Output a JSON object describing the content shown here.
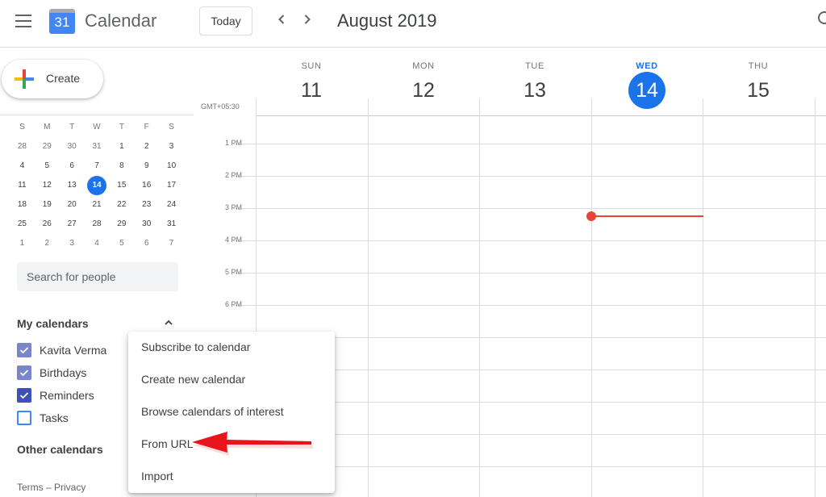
{
  "header": {
    "app_title": "Calendar",
    "logo_number": "31",
    "today_label": "Today",
    "prev_label": "‹",
    "next_label": "›",
    "month_title": "August 2019"
  },
  "sidebar": {
    "create_label": "Create",
    "mini_calendar": {
      "weekdays": [
        "S",
        "M",
        "T",
        "W",
        "T",
        "F",
        "S"
      ],
      "weeks": [
        [
          "28",
          "29",
          "30",
          "31",
          "1",
          "2",
          "3"
        ],
        [
          "4",
          "5",
          "6",
          "7",
          "8",
          "9",
          "10"
        ],
        [
          "11",
          "12",
          "13",
          "14",
          "15",
          "16",
          "17"
        ],
        [
          "18",
          "19",
          "20",
          "21",
          "22",
          "23",
          "24"
        ],
        [
          "25",
          "26",
          "27",
          "28",
          "29",
          "30",
          "31"
        ],
        [
          "1",
          "2",
          "3",
          "4",
          "5",
          "6",
          "7"
        ]
      ],
      "today": "14"
    },
    "search_people_placeholder": "Search for people",
    "my_calendars_title": "My calendars",
    "my_calendars": [
      {
        "label": "Kavita Verma",
        "checked": true,
        "color": "#7986cb"
      },
      {
        "label": "Birthdays",
        "checked": true,
        "color": "#7986cb"
      },
      {
        "label": "Reminders",
        "checked": true,
        "color": "#3f51b5"
      },
      {
        "label": "Tasks",
        "checked": false,
        "color": "#4285f4"
      }
    ],
    "other_calendars_title": "Other calendars",
    "footer": "Terms – Privacy"
  },
  "week_view": {
    "timezone": "GMT+05:30",
    "days": [
      {
        "dow": "SUN",
        "num": "11",
        "today": false
      },
      {
        "dow": "MON",
        "num": "12",
        "today": false
      },
      {
        "dow": "TUE",
        "num": "13",
        "today": false
      },
      {
        "dow": "WED",
        "num": "14",
        "today": true
      },
      {
        "dow": "THU",
        "num": "15",
        "today": false
      }
    ],
    "time_labels": [
      "1 PM",
      "2 PM",
      "3 PM",
      "4 PM",
      "5 PM",
      "6 PM"
    ]
  },
  "add_calendar_menu": {
    "items": [
      "Subscribe to calendar",
      "Create new calendar",
      "Browse calendars of interest",
      "From URL",
      "Import"
    ]
  },
  "annotation": {
    "color": "#e8141c",
    "points_to": "From URL"
  },
  "colors": {
    "accent": "#1a73e8",
    "now_indicator": "#ea4335"
  }
}
